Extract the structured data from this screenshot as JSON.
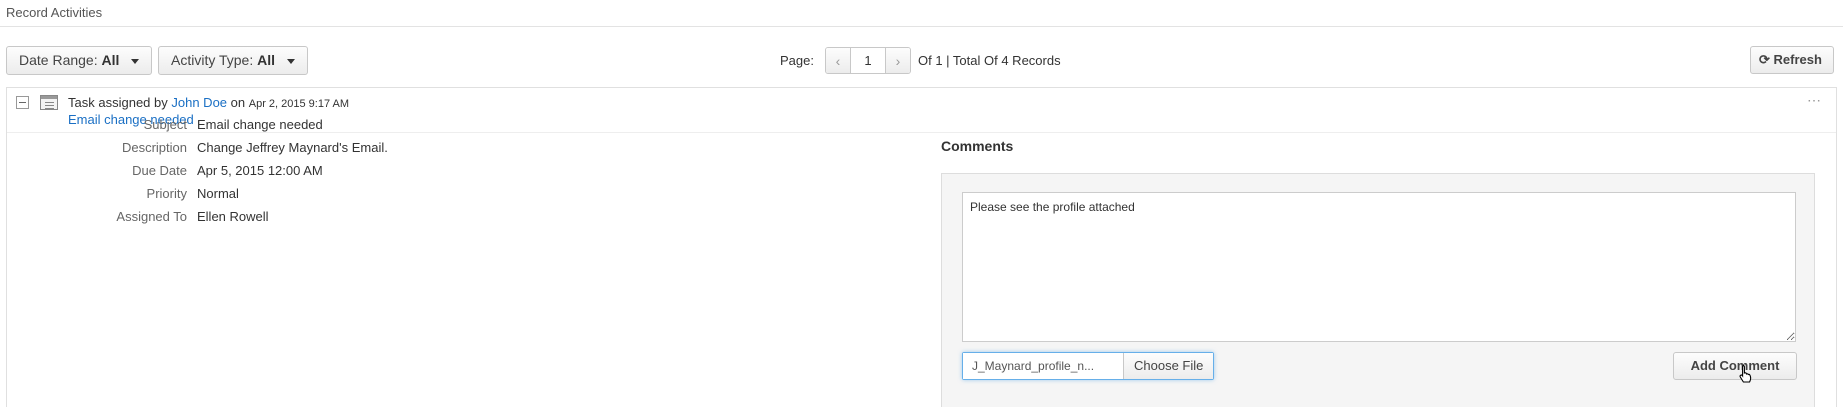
{
  "section": {
    "title": "Record Activities"
  },
  "filters": {
    "date_range_label": "Date Range:",
    "date_range_value": "All",
    "activity_type_label": "Activity Type:",
    "activity_type_value": "All"
  },
  "pager": {
    "label": "Page:",
    "current_page": "1",
    "summary": "Of 1 | Total Of 4 Records"
  },
  "toolbar": {
    "refresh_label": "Refresh"
  },
  "activity": {
    "type": "Task",
    "assigned_by_prefix": "assigned by",
    "assigned_by_user": "John Doe",
    "on_word": "on",
    "timestamp": "Apr 2, 2015 9:17 AM",
    "subject_link": "Email change needed",
    "more": "⋯",
    "details": [
      {
        "label": "Subject",
        "value": "Email change needed"
      },
      {
        "label": "Description",
        "value": "Change Jeffrey Maynard's Email."
      },
      {
        "label": "Due Date",
        "value": "Apr 5, 2015 12:00 AM"
      },
      {
        "label": "Priority",
        "value": "Normal"
      },
      {
        "label": "Assigned To",
        "value": "Ellen Rowell"
      }
    ]
  },
  "comments": {
    "title": "Comments",
    "text": "Please see the profile attached",
    "file_name": "J_Maynard_profile_n...",
    "choose_file_label": "Choose File",
    "add_comment_label": "Add Comment"
  }
}
